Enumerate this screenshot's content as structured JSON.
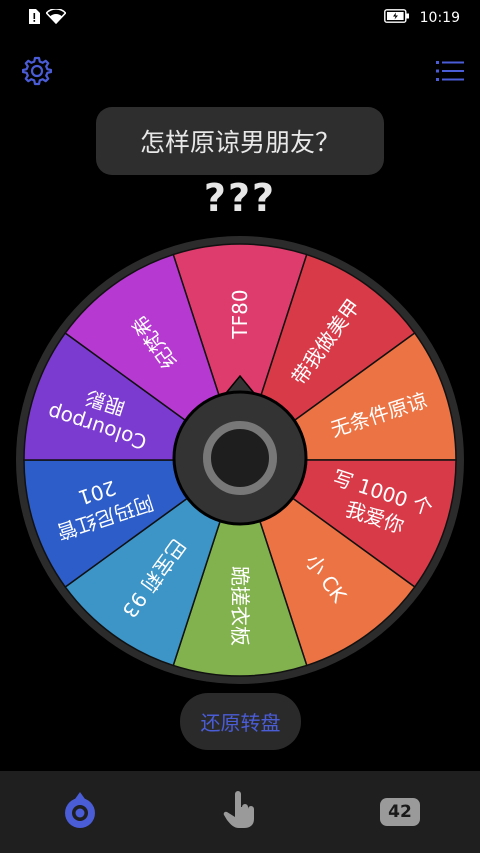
{
  "status_bar": {
    "time": "10:19"
  },
  "header": {
    "question": "怎样原谅男朋友？",
    "result": "???"
  },
  "colors": {
    "accent": "#4a5cd6",
    "pill_bg": "#2e2e2e"
  },
  "wheel": {
    "segments": [
      {
        "label": "TF80",
        "color": "#dd3c6c"
      },
      {
        "label": "带我做美甲",
        "color": "#d93a48"
      },
      {
        "label": "无条件原谅",
        "color": "#ec7343"
      },
      {
        "label": [
          "写 1000 个",
          "我爱你"
        ],
        "color": "#d93a48"
      },
      {
        "label": "小 CK",
        "color": "#ec7343"
      },
      {
        "label": "跪搓衣板",
        "color": "#82b24d"
      },
      {
        "label": "巴宝莉 93",
        "color": "#3c94c7"
      },
      {
        "label": [
          "阿玛尼红管",
          "201"
        ],
        "color": "#2d5dc9"
      },
      {
        "label": [
          "Colourpop",
          "眼影"
        ],
        "color": "#7c3bd0"
      },
      {
        "label": "纪梵希",
        "color": "#b63ad1"
      }
    ]
  },
  "actions": {
    "reset_label": "还原转盘"
  },
  "bottom_nav": {
    "badge_count": "42"
  }
}
